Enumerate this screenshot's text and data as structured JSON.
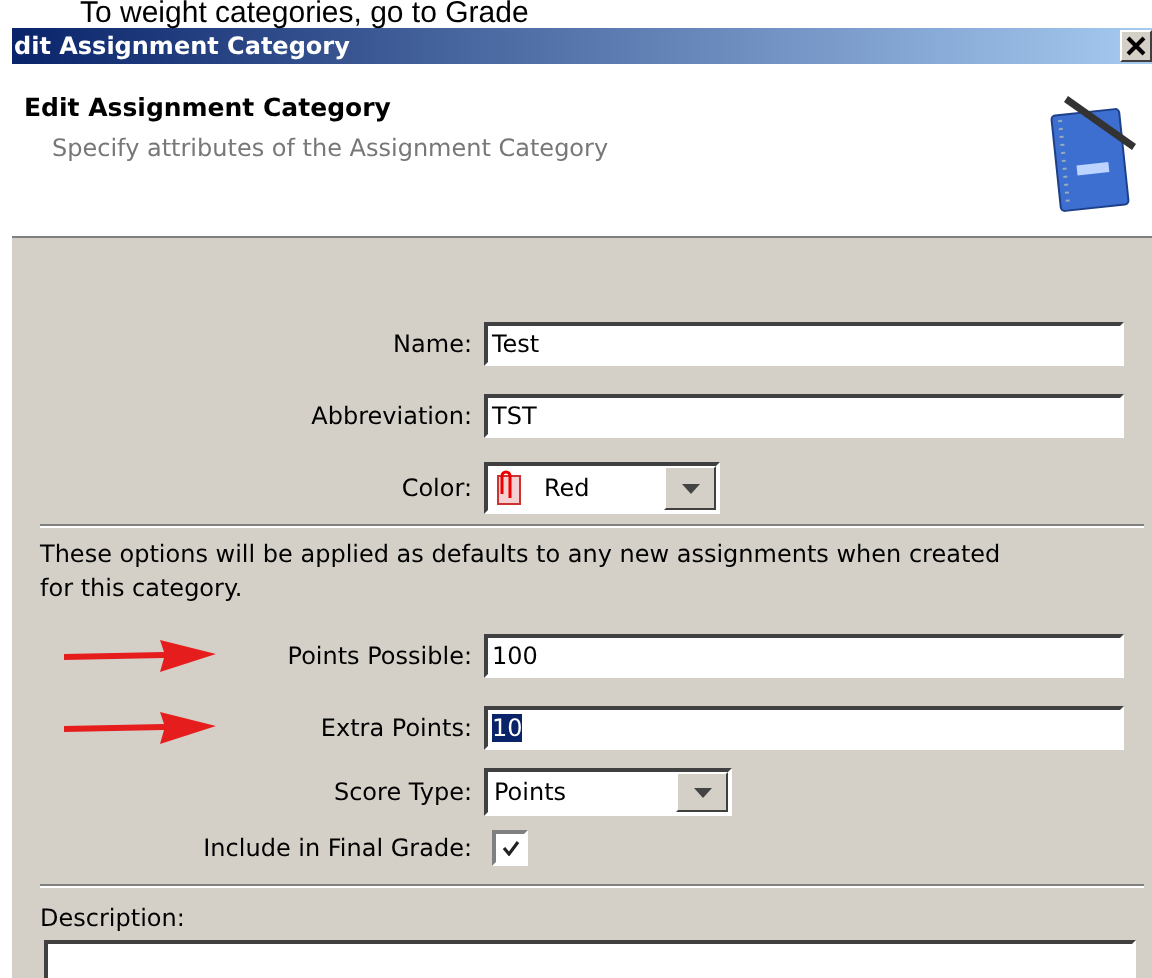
{
  "caption": "To weight categories, go to Grade",
  "window": {
    "title": "dit Assignment Category"
  },
  "header": {
    "title": "Edit Assignment Category",
    "subtitle": "Specify attributes of the Assignment Category"
  },
  "section_1": [
    {
      "kind": "text",
      "label": "Name:",
      "value": "Test"
    },
    {
      "kind": "text",
      "label": "Abbreviation:",
      "value": "TST"
    },
    {
      "kind": "color-combo",
      "label": "Color:",
      "value": "Red"
    }
  ],
  "note": "These options will be applied as defaults to any new assignments when created for this category.",
  "section_2": [
    {
      "kind": "text",
      "label": "Points Possible:",
      "value": "100",
      "arrowed": true
    },
    {
      "kind": "text",
      "label": "Extra Points:",
      "value": "10",
      "arrowed": true,
      "highlighted": true
    },
    {
      "kind": "combo",
      "label": "Score Type:",
      "value": "Points"
    },
    {
      "kind": "checkbox",
      "label": "Include in Final Grade:",
      "checked": true
    }
  ],
  "description": {
    "label": "Description:"
  }
}
